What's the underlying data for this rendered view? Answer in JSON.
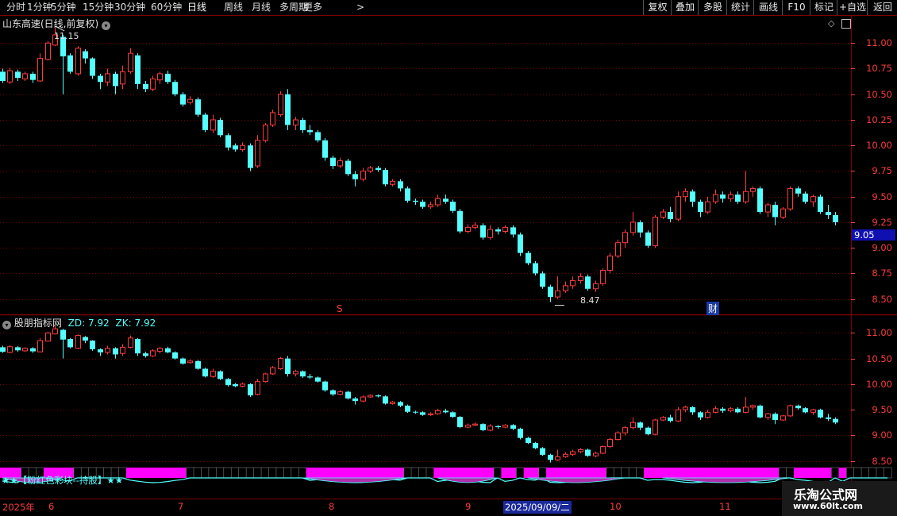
{
  "toolbar": {
    "periods": [
      "分时",
      "1分钟",
      "5分钟",
      "15分钟",
      "30分钟",
      "60分钟",
      "日线",
      "周线",
      "月线",
      "多周期",
      "更多"
    ],
    "active_period": "日线",
    "right_buttons": [
      "复权",
      "叠加",
      "多股",
      "统计",
      "画线",
      "F10",
      "标记",
      "+自选",
      "返回"
    ]
  },
  "main_panel": {
    "title": "山东高速(日线,前复权)",
    "high_label": "11.15",
    "low_label": "8.47",
    "current_price": "9.05",
    "event_s": "S",
    "event_cai": "财",
    "y_ticks": [
      "11.00",
      "10.75",
      "10.50",
      "10.25",
      "10.00",
      "9.75",
      "9.50",
      "9.25",
      "9.00",
      "8.75",
      "8.50"
    ]
  },
  "sub_panel": {
    "title": "股朋指标网",
    "zd_label": "ZD: 7.92",
    "zk_label": "ZK: 7.92",
    "y_ticks": [
      "11.00",
      "10.50",
      "10.00",
      "9.50",
      "9.00",
      "8.50"
    ],
    "strip_label": "★★【粉红色彩块--持股】★★"
  },
  "x_axis": {
    "labels": [
      "2025年",
      "6",
      "7",
      "8",
      "9",
      "2025/09/09/二",
      "10",
      "11"
    ]
  },
  "colors": {
    "up": "#ff3c3c",
    "down": "#54ffff",
    "magenta": "#ff00ff",
    "grid": "#7a0000"
  },
  "watermark": {
    "line1": "乐淘公式网",
    "line2": "www.60lt.com"
  },
  "chart_data": {
    "type": "candlestick",
    "candles": [
      [
        10.72,
        10.63,
        10.75,
        10.61
      ],
      [
        10.62,
        10.73,
        10.76,
        10.6
      ],
      [
        10.72,
        10.66,
        10.74,
        10.63
      ],
      [
        10.65,
        10.7,
        10.72,
        10.63
      ],
      [
        10.7,
        10.64,
        10.72,
        10.61
      ],
      [
        10.63,
        10.85,
        10.9,
        10.62
      ],
      [
        10.84,
        11.0,
        11.02,
        10.83
      ],
      [
        10.98,
        11.08,
        11.15,
        10.97
      ],
      [
        11.06,
        10.87,
        11.08,
        10.5
      ],
      [
        10.88,
        10.72,
        10.9,
        10.7
      ],
      [
        10.7,
        10.95,
        10.97,
        10.68
      ],
      [
        10.92,
        10.85,
        10.94,
        10.8
      ],
      [
        10.85,
        10.68,
        10.86,
        10.65
      ],
      [
        10.68,
        10.62,
        10.7,
        10.55
      ],
      [
        10.62,
        10.7,
        10.75,
        10.58
      ],
      [
        10.7,
        10.58,
        10.72,
        10.5
      ],
      [
        10.6,
        10.72,
        10.78,
        10.55
      ],
      [
        10.72,
        10.9,
        10.95,
        10.7
      ],
      [
        10.88,
        10.6,
        10.9,
        10.55
      ],
      [
        10.6,
        10.55,
        10.63,
        10.52
      ],
      [
        10.55,
        10.65,
        10.68,
        10.53
      ],
      [
        10.64,
        10.7,
        10.72,
        10.6
      ],
      [
        10.7,
        10.62,
        10.73,
        10.6
      ],
      [
        10.62,
        10.5,
        10.64,
        10.48
      ],
      [
        10.5,
        10.4,
        10.52,
        10.38
      ],
      [
        10.42,
        10.45,
        10.48,
        10.4
      ],
      [
        10.45,
        10.3,
        10.47,
        10.28
      ],
      [
        10.3,
        10.15,
        10.32,
        10.13
      ],
      [
        10.15,
        10.25,
        10.3,
        10.12
      ],
      [
        10.25,
        10.1,
        10.27,
        10.08
      ],
      [
        10.1,
        9.98,
        10.12,
        9.95
      ],
      [
        10.0,
        9.96,
        10.02,
        9.94
      ],
      [
        9.96,
        10.0,
        10.03,
        9.94
      ],
      [
        10.0,
        9.78,
        10.02,
        9.75
      ],
      [
        9.8,
        10.05,
        10.1,
        9.78
      ],
      [
        10.05,
        10.2,
        10.22,
        10.03
      ],
      [
        10.2,
        10.32,
        10.35,
        10.18
      ],
      [
        10.3,
        10.5,
        10.53,
        10.28
      ],
      [
        10.5,
        10.2,
        10.55,
        10.15
      ],
      [
        10.2,
        10.25,
        10.28,
        10.15
      ],
      [
        10.25,
        10.15,
        10.27,
        10.12
      ],
      [
        10.15,
        10.13,
        10.2,
        10.1
      ],
      [
        10.13,
        10.05,
        10.15,
        10.03
      ],
      [
        10.05,
        9.88,
        10.07,
        9.85
      ],
      [
        9.88,
        9.8,
        9.9,
        9.77
      ],
      [
        9.8,
        9.85,
        9.88,
        9.78
      ],
      [
        9.85,
        9.72,
        9.87,
        9.7
      ],
      [
        9.72,
        9.67,
        9.75,
        9.6
      ],
      [
        9.67,
        9.75,
        9.78,
        9.65
      ],
      [
        9.75,
        9.78,
        9.8,
        9.73
      ],
      [
        9.78,
        9.76,
        9.8,
        9.74
      ],
      [
        9.76,
        9.62,
        9.78,
        9.6
      ],
      [
        9.62,
        9.65,
        9.67,
        9.6
      ],
      [
        9.65,
        9.58,
        9.67,
        9.55
      ],
      [
        9.58,
        9.46,
        9.6,
        9.44
      ],
      [
        9.46,
        9.45,
        9.48,
        9.42
      ],
      [
        9.45,
        9.4,
        9.47,
        9.38
      ],
      [
        9.4,
        9.42,
        9.45,
        9.38
      ],
      [
        9.42,
        9.48,
        9.52,
        9.4
      ],
      [
        9.48,
        9.45,
        9.52,
        9.43
      ],
      [
        9.45,
        9.36,
        9.47,
        9.34
      ],
      [
        9.36,
        9.16,
        9.38,
        9.14
      ],
      [
        9.16,
        9.2,
        9.23,
        9.14
      ],
      [
        9.2,
        9.22,
        9.25,
        9.18
      ],
      [
        9.22,
        9.1,
        9.24,
        9.08
      ],
      [
        9.1,
        9.18,
        9.22,
        9.08
      ],
      [
        9.18,
        9.16,
        9.2,
        9.13
      ],
      [
        9.16,
        9.2,
        9.22,
        9.14
      ],
      [
        9.2,
        9.13,
        9.22,
        9.1
      ],
      [
        9.13,
        8.95,
        9.15,
        8.92
      ],
      [
        8.95,
        8.85,
        8.97,
        8.83
      ],
      [
        8.85,
        8.75,
        8.87,
        8.73
      ],
      [
        8.75,
        8.62,
        8.77,
        8.6
      ],
      [
        8.62,
        8.52,
        8.64,
        8.47
      ],
      [
        8.52,
        8.58,
        8.72,
        8.5
      ],
      [
        8.58,
        8.63,
        8.67,
        8.56
      ],
      [
        8.63,
        8.68,
        8.72,
        8.6
      ],
      [
        8.68,
        8.72,
        8.75,
        8.65
      ],
      [
        8.72,
        8.6,
        8.74,
        8.58
      ],
      [
        8.6,
        8.65,
        8.68,
        8.57
      ],
      [
        8.65,
        8.78,
        8.8,
        8.63
      ],
      [
        8.78,
        8.92,
        8.95,
        8.75
      ],
      [
        8.92,
        9.05,
        9.08,
        8.9
      ],
      [
        9.05,
        9.15,
        9.18,
        9.0
      ],
      [
        9.15,
        9.25,
        9.35,
        9.12
      ],
      [
        9.25,
        9.15,
        9.27,
        9.1
      ],
      [
        9.15,
        9.02,
        9.17,
        9.0
      ],
      [
        9.02,
        9.3,
        9.32,
        9.0
      ],
      [
        9.3,
        9.35,
        9.38,
        9.28
      ],
      [
        9.35,
        9.28,
        9.4,
        9.25
      ],
      [
        9.28,
        9.5,
        9.55,
        9.26
      ],
      [
        9.5,
        9.55,
        9.58,
        9.45
      ],
      [
        9.55,
        9.45,
        9.57,
        9.4
      ],
      [
        9.45,
        9.35,
        9.47,
        9.3
      ],
      [
        9.35,
        9.45,
        9.5,
        9.33
      ],
      [
        9.45,
        9.52,
        9.57,
        9.43
      ],
      [
        9.52,
        9.48,
        9.55,
        9.44
      ],
      [
        9.48,
        9.52,
        9.55,
        9.45
      ],
      [
        9.52,
        9.45,
        9.55,
        9.43
      ],
      [
        9.45,
        9.55,
        9.75,
        9.43
      ],
      [
        9.55,
        9.58,
        9.6,
        9.5
      ],
      [
        9.58,
        9.35,
        9.6,
        9.33
      ],
      [
        9.35,
        9.42,
        9.44,
        9.3
      ],
      [
        9.42,
        9.3,
        9.45,
        9.22
      ],
      [
        9.3,
        9.38,
        9.4,
        9.28
      ],
      [
        9.38,
        9.58,
        9.6,
        9.36
      ],
      [
        9.58,
        9.53,
        9.6,
        9.5
      ],
      [
        9.53,
        9.45,
        9.55,
        9.43
      ],
      [
        9.45,
        9.5,
        9.52,
        9.4
      ],
      [
        9.5,
        9.35,
        9.52,
        9.33
      ],
      [
        9.35,
        9.32,
        9.42,
        9.28
      ],
      [
        9.32,
        9.25,
        9.35,
        9.22
      ]
    ],
    "ylim_main": [
      8.35,
      11.25
    ],
    "ylim_sub": [
      8.2,
      11.3
    ],
    "strip_states": [
      1,
      1,
      1,
      0,
      0,
      0,
      1,
      1,
      1,
      1,
      0,
      0,
      0,
      0,
      0,
      0,
      0,
      1,
      1,
      1,
      1,
      1,
      1,
      1,
      1,
      0,
      0,
      0,
      0,
      0,
      0,
      0,
      0,
      0,
      0,
      0,
      0,
      0,
      0,
      0,
      0,
      1,
      1,
      1,
      1,
      1,
      1,
      1,
      1,
      1,
      1,
      1,
      1,
      1,
      0,
      0,
      0,
      0,
      1,
      1,
      1,
      1,
      1,
      1,
      1,
      1,
      0,
      1,
      1,
      0,
      1,
      1,
      0,
      1,
      1,
      1,
      1,
      1,
      1,
      1,
      1,
      0,
      0,
      0,
      0,
      0,
      1,
      1,
      1,
      1,
      1,
      1,
      1,
      1,
      1,
      1,
      1,
      1,
      1,
      1,
      1,
      1,
      1,
      1,
      0,
      0,
      1,
      1,
      1,
      1,
      1,
      0,
      1,
      0,
      0,
      0,
      0,
      0,
      0
    ]
  }
}
